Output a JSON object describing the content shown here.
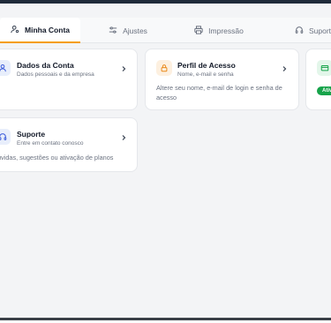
{
  "tabs": [
    {
      "label": "Minha Conta",
      "icon": "user-gear-icon",
      "active": true
    },
    {
      "label": "Ajustes",
      "icon": "sliders-icon",
      "active": false
    },
    {
      "label": "Impressão",
      "icon": "printer-icon",
      "active": false
    },
    {
      "label": "Suporte",
      "icon": "headset-icon",
      "active": false
    }
  ],
  "cards": {
    "dados": {
      "title": "Dados da Conta",
      "subtitle": "Dados pessoais e da empresa",
      "icon": "user-icon"
    },
    "perfil": {
      "title": "Perfil de Acesso",
      "subtitle": "Nome, e-mail e senha",
      "description": "Altere seu nome, e-mail de login e senha de acesso",
      "icon": "lock-icon"
    },
    "plano": {
      "badge": "Ativ",
      "icon": "credit-card-icon"
    },
    "suporte": {
      "title": "Suporte",
      "subtitle": "Entre em contato conosco",
      "description": "úvidas, sugestões ou ativação de planos",
      "icon": "headset-icon"
    }
  },
  "colors": {
    "accent": "#f59e0b",
    "active_badge": "#16a34a",
    "blue_icon_bg": "#e8eefb",
    "orange_icon_bg": "#fdf0e0",
    "green_icon_bg": "#e3f6ea"
  }
}
